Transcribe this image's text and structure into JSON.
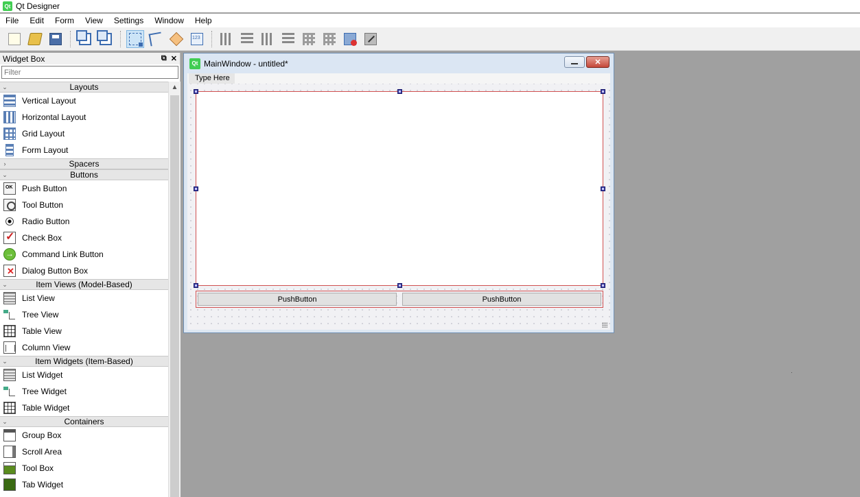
{
  "app": {
    "title": "Qt Designer",
    "logo_text": "Qt"
  },
  "menubar": {
    "items": [
      "File",
      "Edit",
      "Form",
      "View",
      "Settings",
      "Window",
      "Help"
    ]
  },
  "toolbar": {
    "buttons": [
      {
        "name": "new-form",
        "icon": "new-file-icon"
      },
      {
        "name": "open-form",
        "icon": "open-folder-icon"
      },
      {
        "name": "save-form",
        "icon": "save-icon"
      },
      {
        "name": "bring-to-front",
        "icon": "bring-to-front-icon"
      },
      {
        "name": "send-to-back",
        "icon": "send-to-back-icon"
      },
      {
        "name": "edit-widgets",
        "icon": "edit-widgets-icon",
        "active": true
      },
      {
        "name": "edit-signals-slots",
        "icon": "signals-slots-icon"
      },
      {
        "name": "edit-buddies",
        "icon": "buddies-icon"
      },
      {
        "name": "edit-tab-order",
        "icon": "tab-order-icon"
      },
      {
        "name": "lay-out-horizontally",
        "icon": "horizontal-layout-icon"
      },
      {
        "name": "lay-out-vertically",
        "icon": "vertical-layout-icon"
      },
      {
        "name": "lay-out-horizontally-splitter",
        "icon": "horizontal-splitter-icon"
      },
      {
        "name": "lay-out-vertically-splitter",
        "icon": "vertical-splitter-icon"
      },
      {
        "name": "lay-out-grid",
        "icon": "grid-layout-icon"
      },
      {
        "name": "lay-out-form",
        "icon": "form-layout-icon"
      },
      {
        "name": "break-layout",
        "icon": "break-layout-icon"
      },
      {
        "name": "adjust-size",
        "icon": "adjust-size-icon"
      }
    ]
  },
  "widgetbox": {
    "title": "Widget Box",
    "float_icon": "float-icon",
    "close_icon": "close-icon",
    "filter_placeholder": "Filter",
    "categories": [
      {
        "label": "Layouts",
        "expanded": true,
        "items": [
          {
            "label": "Vertical Layout",
            "icon": "vlay"
          },
          {
            "label": "Horizontal Layout",
            "icon": "hlay"
          },
          {
            "label": "Grid Layout",
            "icon": "glay"
          },
          {
            "label": "Form Layout",
            "icon": "flay"
          }
        ]
      },
      {
        "label": "Spacers",
        "expanded": false,
        "items": []
      },
      {
        "label": "Buttons",
        "expanded": true,
        "items": [
          {
            "label": "Push Button",
            "icon": "push"
          },
          {
            "label": "Tool Button",
            "icon": "tool"
          },
          {
            "label": "Radio Button",
            "icon": "radio"
          },
          {
            "label": "Check Box",
            "icon": "check"
          },
          {
            "label": "Command Link Button",
            "icon": "cmdlink"
          },
          {
            "label": "Dialog Button Box",
            "icon": "dlgbox"
          }
        ]
      },
      {
        "label": "Item Views (Model-Based)",
        "expanded": true,
        "items": [
          {
            "label": "List View",
            "icon": "listv"
          },
          {
            "label": "Tree View",
            "icon": "treev"
          },
          {
            "label": "Table View",
            "icon": "tablev"
          },
          {
            "label": "Column View",
            "icon": "colv"
          }
        ]
      },
      {
        "label": "Item Widgets (Item-Based)",
        "expanded": true,
        "items": [
          {
            "label": "List Widget",
            "icon": "listv"
          },
          {
            "label": "Tree Widget",
            "icon": "treev"
          },
          {
            "label": "Table Widget",
            "icon": "tablev"
          }
        ]
      },
      {
        "label": "Containers",
        "expanded": true,
        "items": [
          {
            "label": "Group Box",
            "icon": "groupbox"
          },
          {
            "label": "Scroll Area",
            "icon": "scroll"
          },
          {
            "label": "Tool Box",
            "icon": "toolbox"
          },
          {
            "label": "Tab Widget",
            "icon": "tabw"
          }
        ]
      }
    ]
  },
  "form": {
    "caption": "MainWindow - untitled*",
    "logo_text": "Qt",
    "menu_placeholder": "Type Here",
    "buttons": [
      "PushButton",
      "PushButton"
    ]
  }
}
